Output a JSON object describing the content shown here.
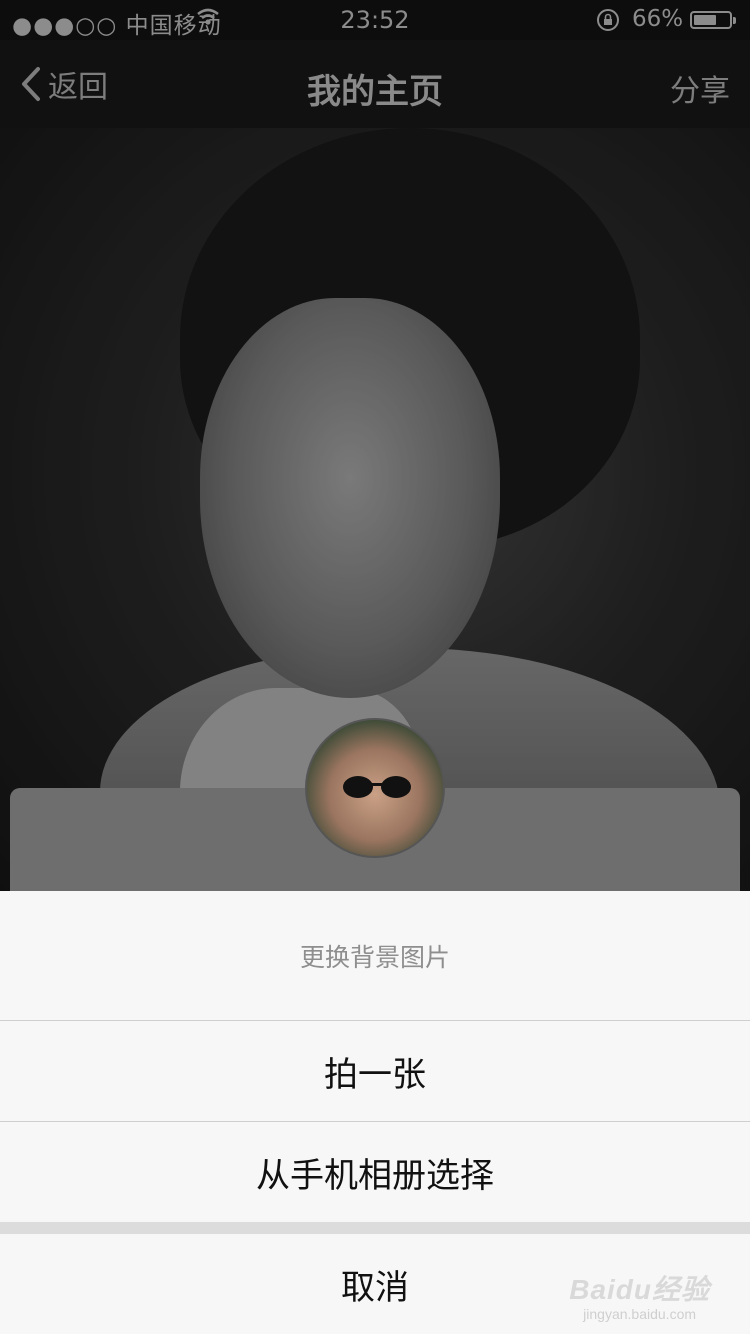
{
  "status_bar": {
    "signal": "●●●○○",
    "carrier": "中国移动",
    "time": "23:52",
    "battery_percent": "66%",
    "battery_level": 0.66
  },
  "nav": {
    "back_label": "返回",
    "title": "我的主页",
    "share_label": "分享"
  },
  "action_sheet": {
    "title": "更换背景图片",
    "take_photo": "拍一张",
    "choose_album": "从手机相册选择",
    "cancel": "取消"
  },
  "watermark": {
    "brand": "Baidu经验",
    "url": "jingyan.baidu.com"
  },
  "colors": {
    "sheet_bg": "#f7f7f7",
    "nav_bg": "#111111"
  }
}
